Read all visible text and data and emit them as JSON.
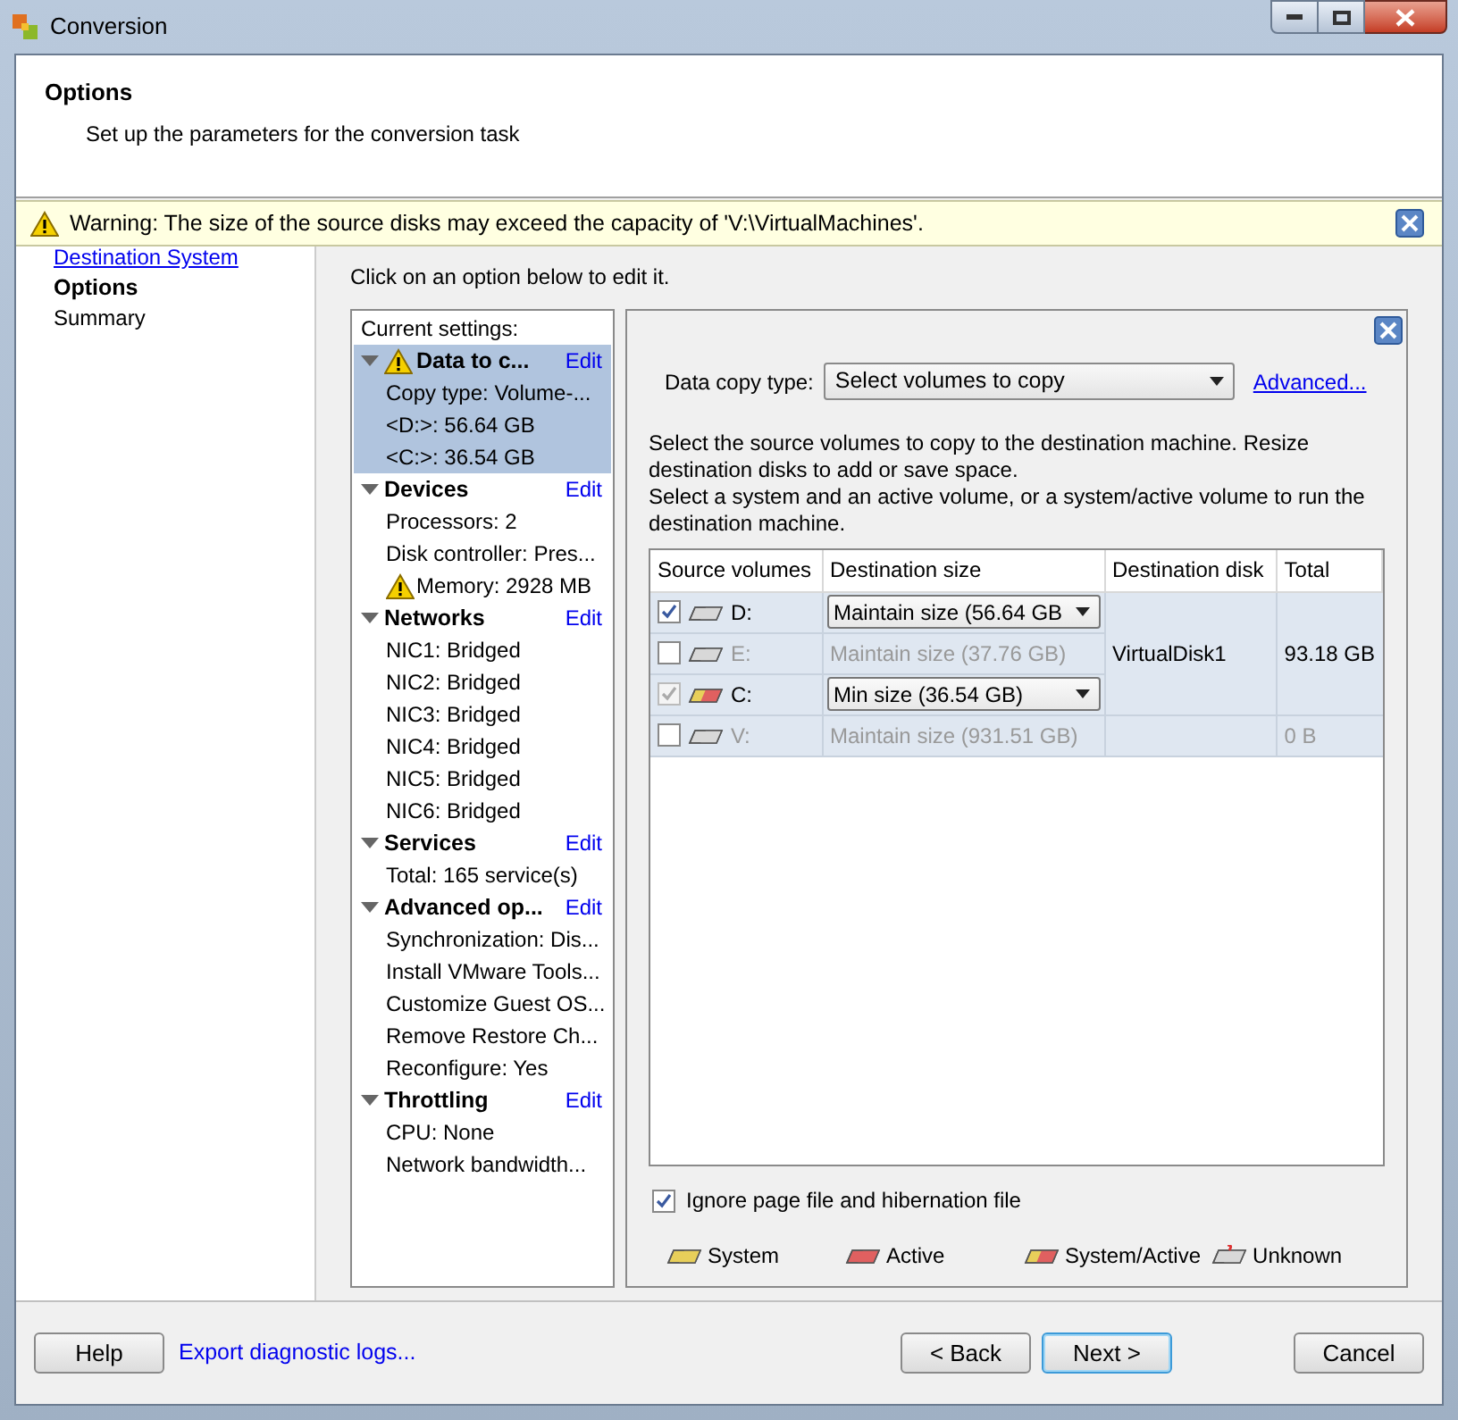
{
  "window": {
    "title": "Conversion"
  },
  "header": {
    "title": "Options",
    "subtitle": "Set up the parameters for the conversion task"
  },
  "warning": {
    "text": "Warning: The size of the source disks may exceed the capacity of 'V:\\VirtualMachines'."
  },
  "steps": [
    {
      "label": "Destination System",
      "kind": "link",
      "selected": false
    },
    {
      "label": "Options",
      "kind": "text",
      "selected": true
    },
    {
      "label": "Summary",
      "kind": "text",
      "selected": false
    }
  ],
  "instruction": "Click on an option below to edit it.",
  "settings": {
    "title": "Current settings:",
    "sections": [
      {
        "title": "Data to c...",
        "edit": "Edit",
        "warning": true,
        "selected": true,
        "expanded": true,
        "items": [
          {
            "text": "Copy type: Volume-...",
            "warning": false
          },
          {
            "text": "<D:>: 56.64 GB",
            "warning": false
          },
          {
            "text": "<C:>: 36.54 GB",
            "warning": false
          }
        ]
      },
      {
        "title": "Devices",
        "edit": "Edit",
        "warning": false,
        "selected": false,
        "expanded": true,
        "items": [
          {
            "text": "Processors: 2",
            "warning": false
          },
          {
            "text": "Disk controller: Pres...",
            "warning": false
          },
          {
            "text": "Memory: 2928 MB",
            "warning": true
          }
        ]
      },
      {
        "title": "Networks",
        "edit": "Edit",
        "warning": false,
        "selected": false,
        "expanded": true,
        "items": [
          {
            "text": "NIC1: Bridged",
            "warning": false
          },
          {
            "text": "NIC2: Bridged",
            "warning": false
          },
          {
            "text": "NIC3: Bridged",
            "warning": false
          },
          {
            "text": "NIC4: Bridged",
            "warning": false
          },
          {
            "text": "NIC5: Bridged",
            "warning": false
          },
          {
            "text": "NIC6: Bridged",
            "warning": false
          }
        ]
      },
      {
        "title": "Services",
        "edit": "Edit",
        "warning": false,
        "selected": false,
        "expanded": true,
        "items": [
          {
            "text": "Total: 165 service(s)",
            "warning": false
          }
        ]
      },
      {
        "title": "Advanced op...",
        "edit": "Edit",
        "warning": false,
        "selected": false,
        "expanded": true,
        "items": [
          {
            "text": "Synchronization: Dis...",
            "warning": false
          },
          {
            "text": "Install VMware Tools...",
            "warning": false
          },
          {
            "text": "Customize Guest OS...",
            "warning": false
          },
          {
            "text": "Remove Restore Ch...",
            "warning": false
          },
          {
            "text": "Reconfigure: Yes",
            "warning": false
          }
        ]
      },
      {
        "title": "Throttling",
        "edit": "Edit",
        "warning": false,
        "selected": false,
        "expanded": true,
        "items": [
          {
            "text": "CPU: None",
            "warning": false
          },
          {
            "text": "Network bandwidth...",
            "warning": false
          }
        ]
      }
    ]
  },
  "editor": {
    "copy_type_label": "Data copy type:",
    "copy_type_value": "Select volumes to copy",
    "advanced_link": "Advanced...",
    "description": [
      "Select the source volumes to copy to the destination machine. Resize destination disks to add or save space.",
      "Select a system and an active volume, or a system/active volume to run the destination machine."
    ],
    "table": {
      "columns": [
        "Source volumes",
        "Destination size",
        "Destination disk",
        "Total"
      ],
      "disks": [
        {
          "name": "VirtualDisk1",
          "total": "93.18 GB",
          "volumes": [
            {
              "volume": "D:",
              "kind": "normal",
              "checked": true,
              "checkbox_disabled": false,
              "disabled": false,
              "size": "Maintain size (56.64 GB",
              "editable": true
            },
            {
              "volume": "E:",
              "kind": "normal",
              "checked": false,
              "checkbox_disabled": false,
              "disabled": true,
              "size": "Maintain size (37.76 GB)",
              "editable": false
            },
            {
              "volume": "C:",
              "kind": "system_active",
              "checked": true,
              "checkbox_disabled": true,
              "disabled": false,
              "size": "Min size (36.54 GB)",
              "editable": true
            }
          ]
        },
        {
          "total": "0 B",
          "volumes": [
            {
              "volume": "V:",
              "kind": "normal",
              "checked": false,
              "checkbox_disabled": false,
              "disabled": true,
              "size": "Maintain size (931.51 GB)",
              "editable": false
            }
          ]
        }
      ]
    },
    "ignore_option": {
      "label": "Ignore page file and hibernation file",
      "checked": true
    },
    "legend": [
      {
        "label": "System",
        "kind": "system"
      },
      {
        "label": "Active",
        "kind": "active"
      },
      {
        "label": "System/Active",
        "kind": "system_active"
      },
      {
        "label": "Unknown",
        "kind": "unknown"
      }
    ]
  },
  "footer": {
    "help": "Help",
    "export_link": "Export diagnostic logs...",
    "back": "< Back",
    "next": "Next >",
    "cancel": "Cancel"
  }
}
